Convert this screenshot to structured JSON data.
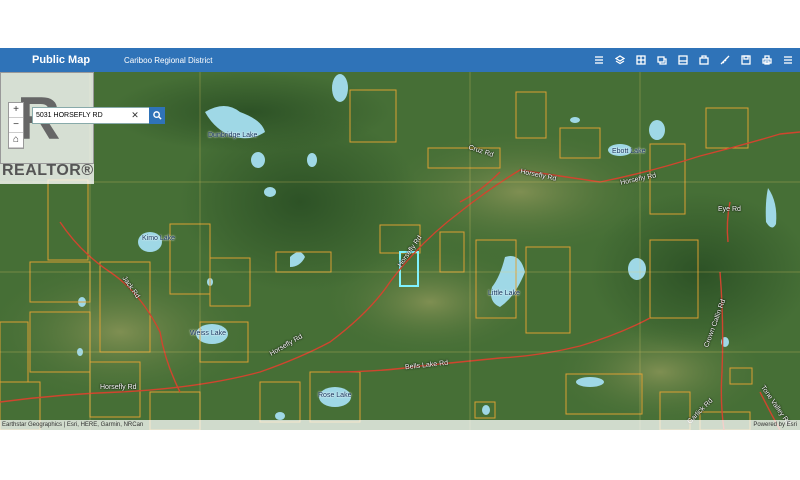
{
  "header": {
    "app_title": "Public Map",
    "district": "Cariboo Regional District",
    "tools": [
      "list-icon",
      "layers-icon",
      "basemap-icon",
      "bookmark-icon",
      "print-map-icon",
      "select-icon",
      "measure-icon",
      "save-icon",
      "print-icon",
      "more-icon"
    ]
  },
  "search": {
    "value": "5031 HORSEFLY RD",
    "clear": "✕"
  },
  "zoom": {
    "in": "+",
    "out": "−",
    "home": "⌂"
  },
  "watermark": {
    "text": "REALTOR®"
  },
  "map_labels": {
    "lake_top": "Dunbridge Lake",
    "lake_right": "Ebott Lake",
    "lake_mid_left": "Kimo Lake",
    "lake_mid": "Little Lake",
    "lake_bottom_left": "Weiss Lake",
    "lake_bottom": "Rose Lake",
    "road_top": "Horsefly Rd",
    "road_diag": "Horsefly Rd",
    "road_diag2": "Horsefly Rd",
    "road_bottom1": "Horsefly Rd",
    "road_bottom2": "Horsefly Rd",
    "road_bells": "Bells Lake Rd",
    "road_cruz": "Cruz Rd",
    "road_eye": "Eye Rd",
    "road_jack": "Jack Rd",
    "road_crown": "Crown Callin Rd",
    "road_garlick": "Garlick Rd",
    "road_tone": "Tone Valley Rd"
  },
  "attribution": {
    "left": "Earthstar Geographics | Esri, HERE, Garmin, NRCan",
    "right": "Powered by Esri"
  }
}
